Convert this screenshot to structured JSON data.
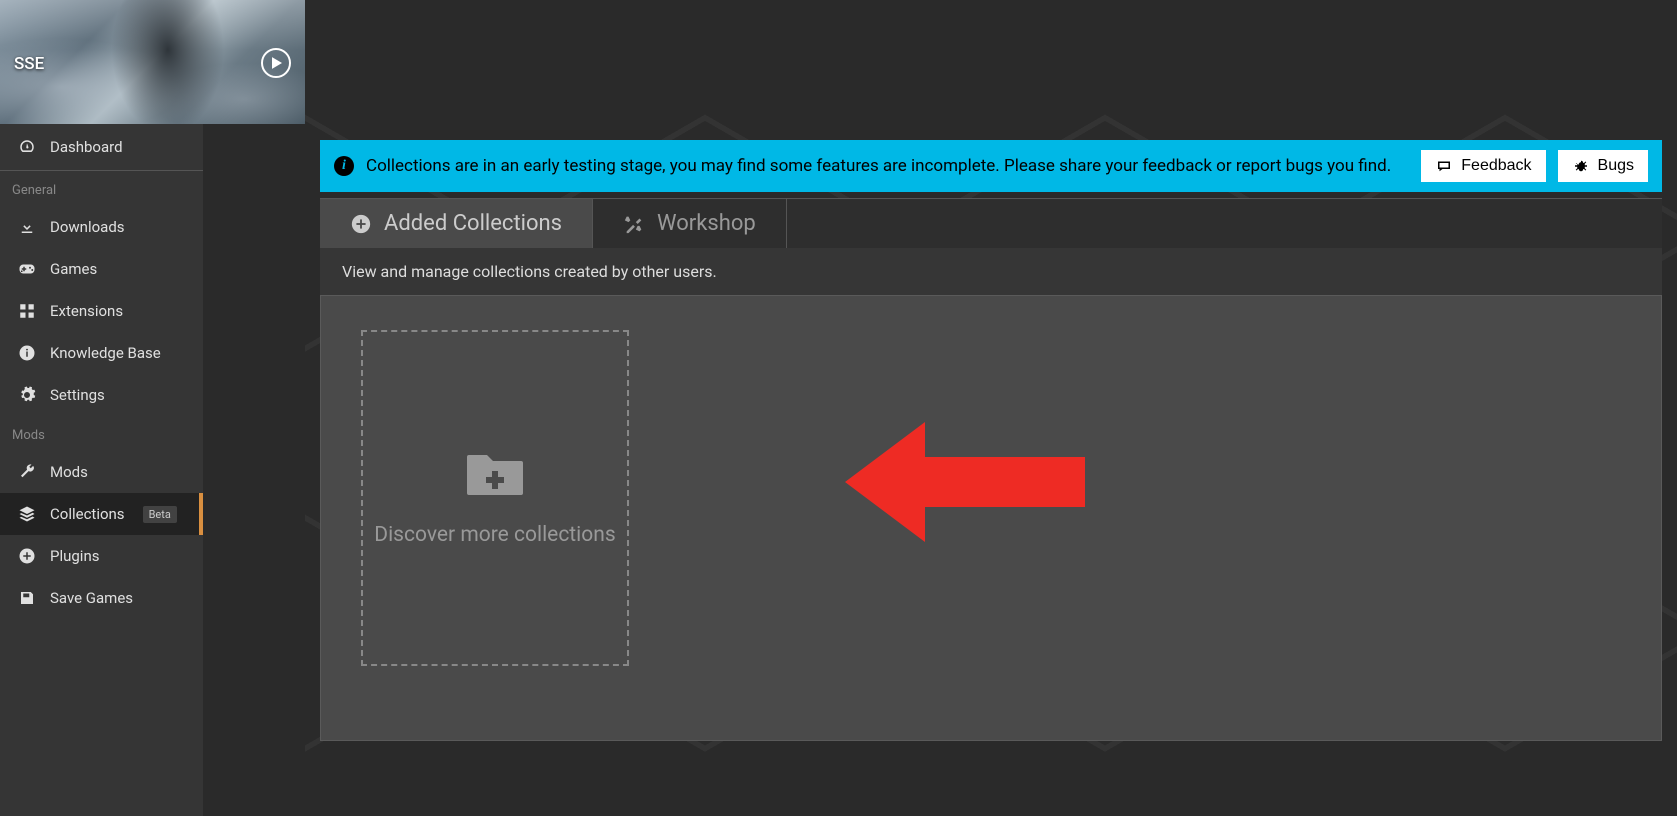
{
  "game": {
    "short_name": "SSE"
  },
  "sidebar": {
    "dashboard_label": "Dashboard",
    "sections": {
      "general": {
        "label": "General",
        "items": [
          {
            "label": "Downloads"
          },
          {
            "label": "Games"
          },
          {
            "label": "Extensions"
          },
          {
            "label": "Knowledge Base"
          },
          {
            "label": "Settings"
          }
        ]
      },
      "mods": {
        "label": "Mods",
        "items": [
          {
            "label": "Mods"
          },
          {
            "label": "Collections",
            "badge": "Beta"
          },
          {
            "label": "Plugins"
          },
          {
            "label": "Save Games"
          }
        ]
      }
    }
  },
  "notice": {
    "text": "Collections are in an early testing stage, you may find some features are incomplete. Please share your feedback or report bugs you find.",
    "feedback_label": "Feedback",
    "bugs_label": "Bugs"
  },
  "tabs": [
    {
      "label": "Added Collections"
    },
    {
      "label": "Workshop"
    }
  ],
  "description": "View and manage collections created by other users.",
  "discover_card": {
    "text": "Discover more collections"
  }
}
